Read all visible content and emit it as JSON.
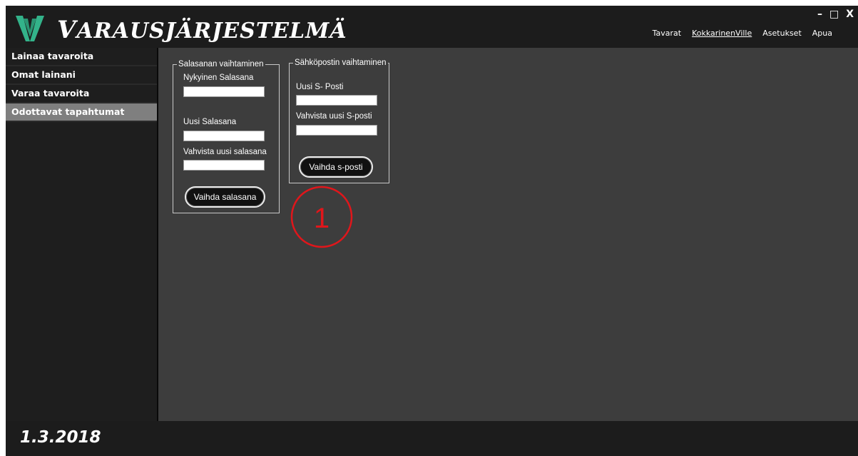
{
  "app": {
    "title_first": "V",
    "title_rest": "ARAUSJÄRJESTELMÄ"
  },
  "window_controls": {
    "minimize": "–",
    "maximize": "□",
    "close": "X"
  },
  "topnav": {
    "items": [
      "Tavarat",
      "KokkarinenVille",
      "Asetukset",
      "Apua"
    ]
  },
  "sidebar": {
    "items": [
      {
        "label": "Lainaa tavaroita"
      },
      {
        "label": "Omat lainani"
      },
      {
        "label": "Varaa tavaroita"
      },
      {
        "label": "Odottavat tapahtumat",
        "active": true
      }
    ]
  },
  "password_group": {
    "legend": "Salasanan vaihtaminen",
    "current_label": "Nykyinen Salasana",
    "current_value": "",
    "new_label": "Uusi Salasana",
    "new_value": "",
    "confirm_label": "Vahvista uusi salasana",
    "confirm_value": "",
    "button": "Vaihda salasana"
  },
  "email_group": {
    "legend": "Sähköpostin vaihtaminen",
    "new_label": "Uusi S- Posti",
    "new_value": "",
    "confirm_label": "Vahvista uusi S-posti",
    "confirm_value": "",
    "button": "Vaihda s-posti"
  },
  "annotation": {
    "text": "1",
    "color": "#e0161b"
  },
  "footer": {
    "date": "1.3.2018"
  },
  "colors": {
    "background": "#3d3d3d",
    "sidebar": "#1e1e1e",
    "active_item": "#7f7f7f",
    "titlebar": "#1c1c1c",
    "logo": "#33b38a"
  }
}
